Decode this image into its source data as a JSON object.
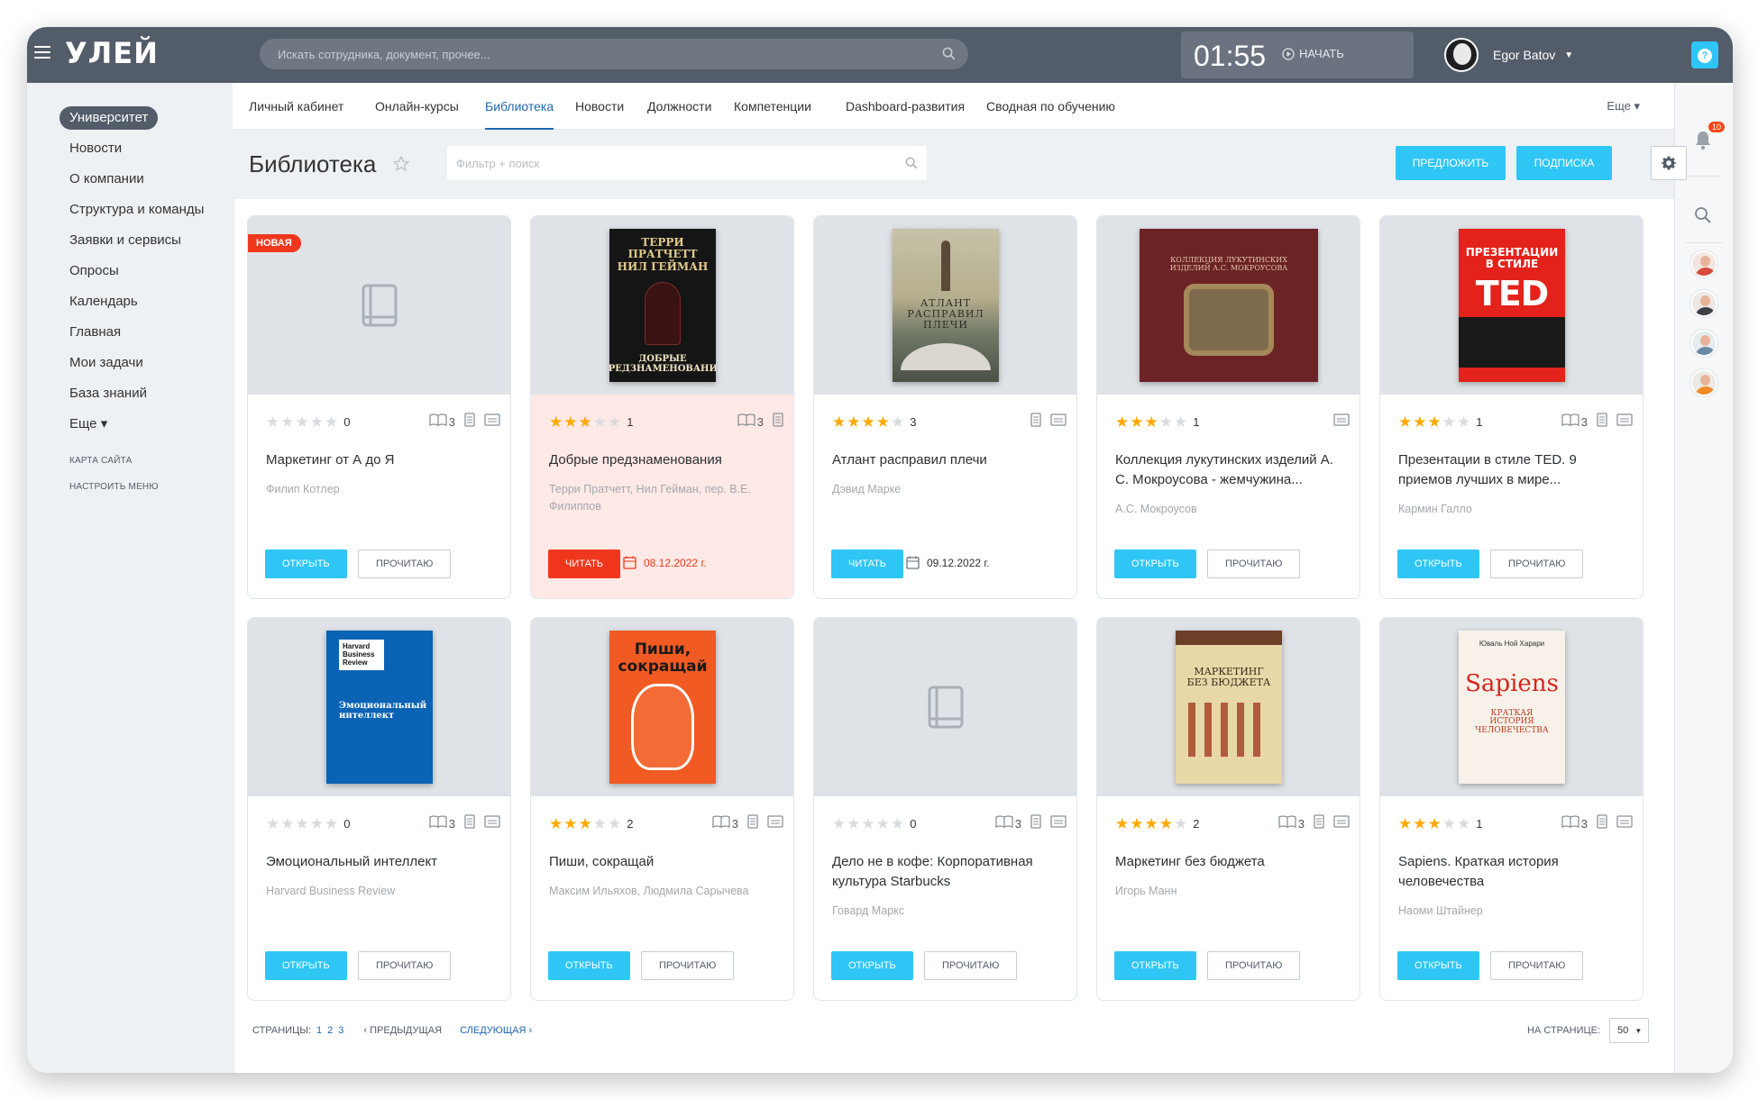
{
  "header": {
    "logo": "УЛЕЙ",
    "search_placeholder": "Искать сотрудника, документ, прочее...",
    "timer": "01:55",
    "start_label": "НАЧАТЬ",
    "user_name": "Egor Batov",
    "help": "?"
  },
  "sidebar": {
    "items": [
      "Университет",
      "Новости",
      "О компании",
      "Структура и команды",
      "Заявки и сервисы",
      "Опросы",
      "Календарь",
      "Главная",
      "Мои задачи",
      "База знаний",
      "Еще ▾"
    ],
    "links": [
      "КАРТА САЙТА",
      "НАСТРОИТЬ МЕНЮ"
    ]
  },
  "rail": {
    "notifications": "10"
  },
  "tabs": [
    "Личный кабинет",
    "Онлайн-курсы",
    "Библиотека",
    "Новости",
    "Должности",
    "Компетенции",
    "Dashboard-развития",
    "Сводная по обучению"
  ],
  "tabs_more": "Еще ▾",
  "page": {
    "title": "Библиотека",
    "filter_placeholder": "Фильтр + поиск",
    "propose": "ПРЕДЛОЖИТЬ",
    "subscribe": "ПОДПИСКА"
  },
  "books": [
    {
      "title": "Маркетинг от А до Я",
      "author": "Филип Котлер",
      "rating": 0,
      "count": "0",
      "badge": "НОВАЯ",
      "btn": "ОТКРЫТЬ",
      "btn2": "ПРОЧИТАЮ"
    },
    {
      "title": "Добрые предзнаменования",
      "author": "Терри Пратчетт, Нил Гейман, пер. В.Е. Филиппов",
      "rating": 3,
      "count": "1",
      "cover_text": "ТЕРРИ ПРАТЧЕТТ НИЛ ГЕЙМАН · ДОБРЫЕ ПРЕДЗНАМЕНОВАНИЯ",
      "btn": "ЧИТАТЬ",
      "due": "08.12.2022 г."
    },
    {
      "title": "Атлант расправил плечи",
      "author": "Дэвид Марке",
      "rating": 4,
      "count": "3",
      "cover_text": "АТЛАНТ РАСПРАВИЛ ПЛЕЧИ",
      "btn": "ЧИТАТЬ",
      "due": "09.12.2022 г."
    },
    {
      "title": "Коллекция лукутинских изделий А. С. Мокроусова - жемчужина...",
      "author": "А.С. Мокроусов",
      "rating": 3,
      "count": "1",
      "cover_text": "КОЛЛЕКЦИЯ ЛУКУТИНСКИХ ИЗДЕЛИЙ А.С. МОКРОУСОВА",
      "btn": "ОТКРЫТЬ",
      "btn2": "ПРОЧИТАЮ"
    },
    {
      "title": "Презентации в стиле TED. 9 приемов лучших в мире...",
      "author": "Кармин Галло",
      "rating": 3,
      "count": "1",
      "cover_text": "ПРЕЗЕНТАЦИИ В СТИЛЕ TED",
      "btn": "ОТКРЫТЬ",
      "btn2": "ПРОЧИТАЮ"
    },
    {
      "title": "Эмоциональный интеллект",
      "author": "Harvard Business Review",
      "rating": 0,
      "count": "0",
      "cover_text": "Harvard Business Review · Эмоциональный интеллект",
      "btn": "ОТКРЫТЬ",
      "btn2": "ПРОЧИТАЮ"
    },
    {
      "title": "Пиши, сокращай",
      "author": "Максим Ильяхов, Людмила Сарычева",
      "rating": 3,
      "count": "2",
      "cover_text": "Пиши, сокращай",
      "btn": "ОТКРЫТЬ",
      "btn2": "ПРОЧИТАЮ"
    },
    {
      "title": "Дело не в кофе: Корпоративная культура Starbucks",
      "author": "Говард Маркс",
      "rating": 0,
      "count": "0",
      "btn": "ОТКРЫТЬ",
      "btn2": "ПРОЧИТАЮ"
    },
    {
      "title": "Маркетинг без бюджета",
      "author": "Игорь Манн",
      "rating": 4,
      "count": "2",
      "cover_text": "МАРКЕТИНГ БЕЗ БЮДЖЕТА",
      "btn": "ОТКРЫТЬ",
      "btn2": "ПРОЧИТАЮ"
    },
    {
      "title": "Sapiens. Краткая история человечества",
      "author": "Наоми Штайнер",
      "rating": 3,
      "count": "1",
      "cover_text": "Sapiens · КРАТКАЯ ИСТОРИЯ ЧЕЛОВЕЧЕСТВА",
      "btn": "ОТКРЫТЬ",
      "btn2": "ПРОЧИТАЮ"
    }
  ],
  "icon_counts": {
    "pages": "3"
  },
  "pagination": {
    "label": "СТРАНИЦЫ:",
    "pages": [
      "1",
      "2",
      "3"
    ],
    "prev": "ПРЕДЫДУЩАЯ",
    "next": "СЛЕДУЮЩАЯ",
    "per_page_label": "НА СТРАНИЦЕ:",
    "per_page": "50"
  },
  "colors": {
    "accent": "#2fc6f6",
    "header": "#535c69",
    "danger": "#f0371d",
    "star": "#ffa900"
  }
}
